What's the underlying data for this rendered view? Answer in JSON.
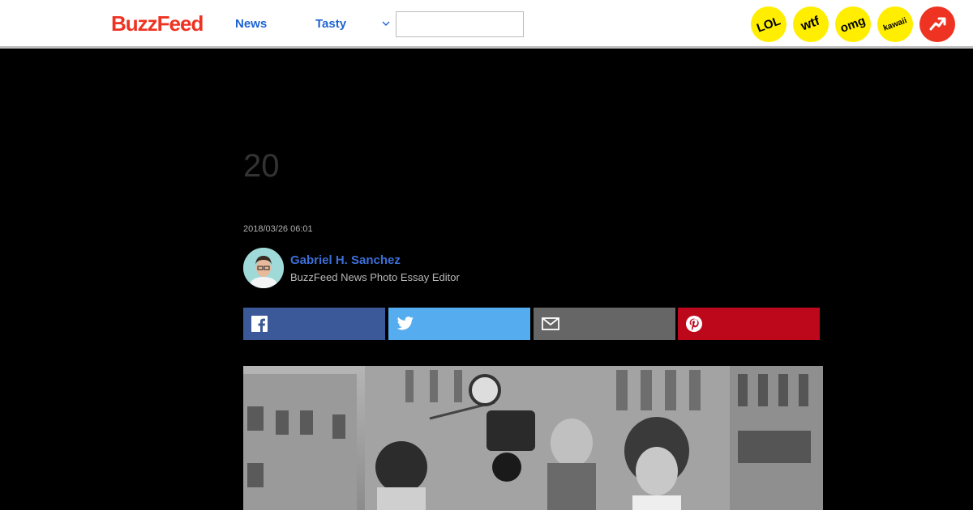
{
  "header": {
    "logo": "BuzzFeed",
    "nav": [
      {
        "label": "News"
      },
      {
        "label": "Tasty"
      }
    ],
    "dropdown_icon": "chevron-down-icon",
    "search": {
      "value": "",
      "placeholder": ""
    },
    "badges": [
      {
        "label": "LOL",
        "color": "#ffee00"
      },
      {
        "label": "wtf",
        "color": "#ffee00"
      },
      {
        "label": "omg",
        "color": "#ffee00"
      },
      {
        "label": "kawaii",
        "color": "#ffee00"
      },
      {
        "icon": "trending-icon",
        "color": "#ee3322"
      }
    ]
  },
  "article": {
    "headline": "20",
    "timestamp": "2018/03/26 06:01",
    "author": {
      "name": "Gabriel H. Sanchez",
      "title": "BuzzFeed News Photo Essay Editor"
    }
  },
  "share_buttons": [
    {
      "icon": "facebook-icon",
      "color": "#3b5998"
    },
    {
      "icon": "twitter-icon",
      "color": "#55acee"
    },
    {
      "icon": "email-icon",
      "color": "#666666"
    },
    {
      "icon": "pinterest-icon",
      "color": "#bd081c"
    }
  ],
  "colors": {
    "brand": "#ee3322",
    "link": "#1e63d0",
    "background": "#000000"
  }
}
